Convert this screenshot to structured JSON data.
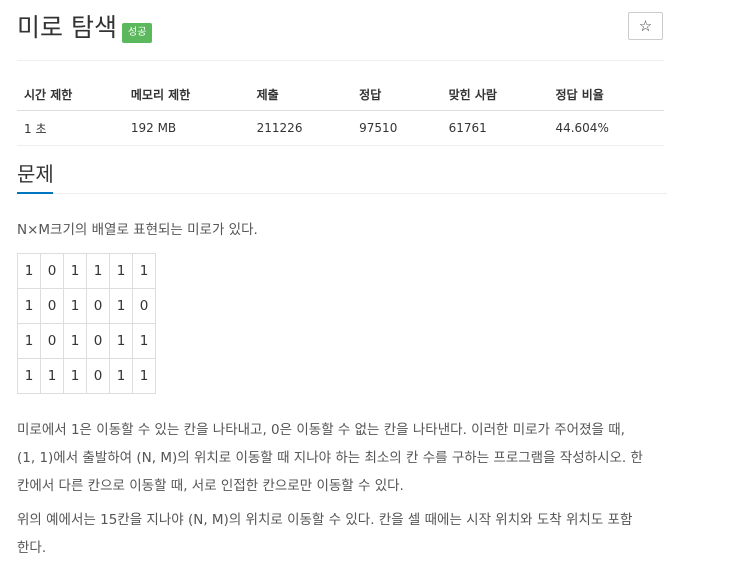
{
  "problem": {
    "title": "미로 탐색",
    "badge": "성공",
    "star_icon": "☆"
  },
  "info": {
    "headers": [
      "시간 제한",
      "메모리 제한",
      "제출",
      "정답",
      "맞힌 사람",
      "정답 비율"
    ],
    "values": [
      "1 초",
      "192 MB",
      "211226",
      "97510",
      "61761",
      "44.604%"
    ]
  },
  "section": {
    "title": "문제",
    "accent_color": "#0076c0"
  },
  "description": {
    "intro": "N×M크기의 배열로 표현되는 미로가 있다.",
    "maze": [
      [
        "1",
        "0",
        "1",
        "1",
        "1",
        "1"
      ],
      [
        "1",
        "0",
        "1",
        "0",
        "1",
        "0"
      ],
      [
        "1",
        "0",
        "1",
        "0",
        "1",
        "1"
      ],
      [
        "1",
        "1",
        "1",
        "0",
        "1",
        "1"
      ]
    ],
    "para1_line1": "미로에서 1은 이동할 수 있는 칸을 나타내고, 0은 이동할 수 없는 칸을 나타낸다. 이러한 미로가 주어졌을 때,",
    "para1_line2": "(1, 1)에서 출발하여 (N, M)의 위치로 이동할 때 지나야 하는 최소의 칸 수를 구하는 프로그램을 작성하시오. 한",
    "para1_line3": "칸에서 다른 칸으로 이동할 때, 서로 인접한 칸으로만 이동할 수 있다.",
    "para2_line1": "위의 예에서는 15칸을 지나야 (N, M)의 위치로 이동할 수 있다. 칸을 셀 때에는 시작 위치와 도착 위치도 포함",
    "para2_line2": "한다."
  }
}
